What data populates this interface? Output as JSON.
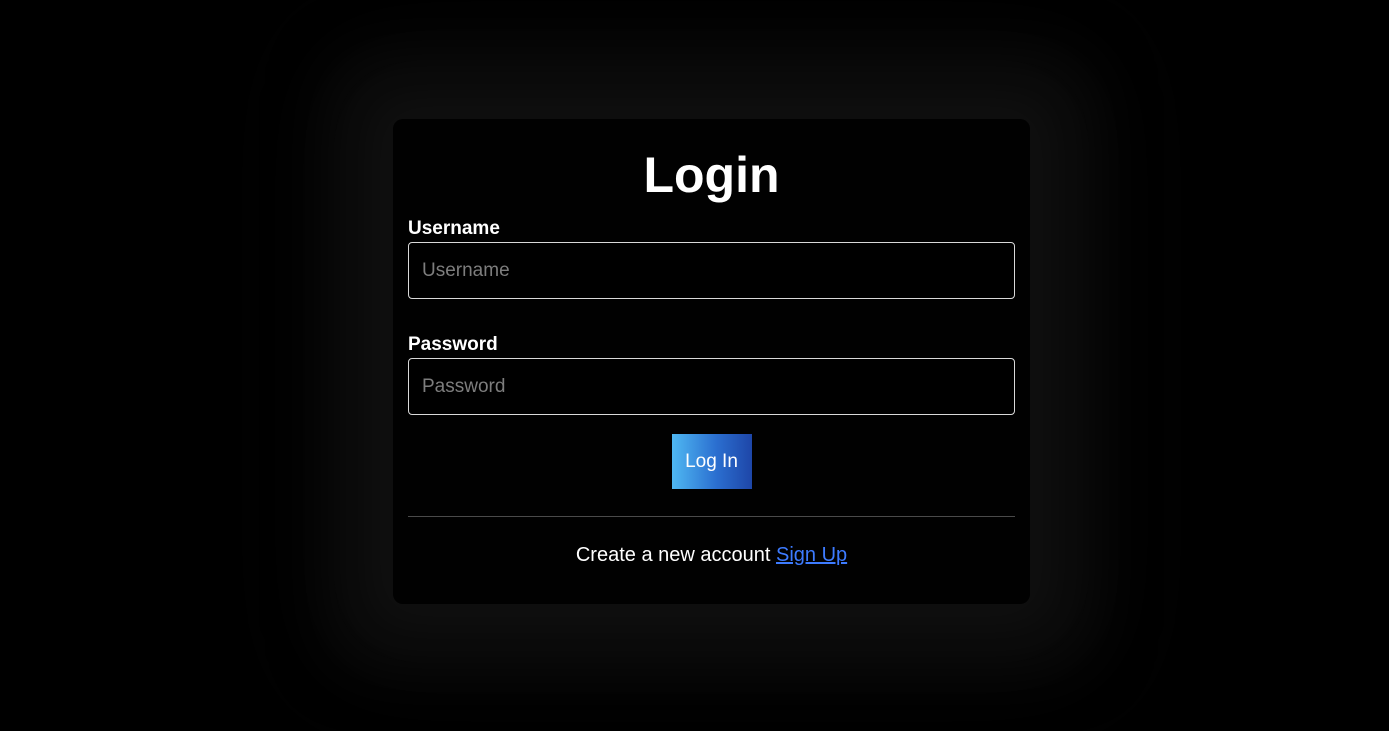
{
  "login": {
    "title": "Login",
    "username": {
      "label": "Username",
      "placeholder": "Username",
      "value": ""
    },
    "password": {
      "label": "Password",
      "placeholder": "Password",
      "value": ""
    },
    "submit_label": "Log In",
    "signup_prompt": "Create a new account",
    "signup_link": "Sign Up"
  },
  "colors": {
    "background": "#000000",
    "card": "#010101",
    "input_border": "#d9d9d9",
    "button_gradient_start": "#4fb8f2",
    "button_gradient_end": "#1e46a8",
    "link": "#3d7bff",
    "divider": "#4a4a4a"
  }
}
